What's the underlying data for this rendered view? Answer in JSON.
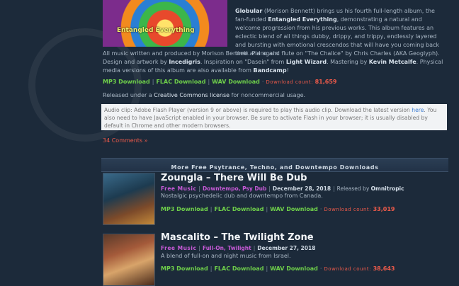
{
  "featured": {
    "art_title": "Entangled Everything",
    "paragraph1": {
      "artist": "Globular",
      "p1": " (Morison Bennett) brings us his fourth full-length album, the fan-funded ",
      "album": "Entangled Everything",
      "p2": ", demonstrating a natural and welcome progression from his previous works. This album features an eclectic blend of all things dubby, drippy, and trippy, endlessly layered and bursting with emotional crescendos that will have you coming back time and again."
    },
    "paragraph2": {
      "p1": "All music written and produced by Morison Bennett. Piano and flute on \"The Chalice\" by Chris Charles (AKA Geoglyph). Design and artwork by ",
      "designer": "Incedigris",
      "p2": ". Inspiration on \"Dasein\" from ",
      "inspiration": "Light Wizard",
      "p3": ". Mastering by ",
      "mastering": "Kevin Metcalfe",
      "p4": ". Physical media versions of this album are also available from ",
      "store": "Bandcamp",
      "p5": "!"
    },
    "downloads": {
      "mp3": "MP3 Download",
      "flac": "FLAC Download",
      "wav": "WAV Download",
      "count_label": "Download count:",
      "count": "81,659"
    },
    "license": {
      "p1": "Released under a ",
      "link": "Creative Commons license",
      "p2": " for noncommercial usage."
    },
    "audio_box": {
      "p1": "Audio clip: Adobe Flash Player (version 9 or above) is required to play this audio clip. Download the latest version ",
      "link": "here",
      "p2": ". You also need to have JavaScript enabled in your browser. Be sure to activate Flash in your browser; it is usually disabled by default in Chrome and other modern browsers."
    },
    "comments": "34 Comments »"
  },
  "section_header": "More Free Psytrance, Techno, and Downtempo Downloads",
  "entries": [
    {
      "title": "Zoungla – There Will Be Dub",
      "category": "Free Music",
      "genres": "Downtempo, Psy Dub",
      "date": "December 28, 2018",
      "release_prefix": "Released by",
      "label": "Omnitropic",
      "description": "Nostalgic psychedelic dub and downtempo from Canada.",
      "mp3": "MP3 Download",
      "flac": "FLAC Download",
      "wav": "WAV Download",
      "count_label": "Download count:",
      "count": "33,019"
    },
    {
      "title": "Mascalito – The Twilight Zone",
      "category": "Free Music",
      "genres": "Full-On, Twilight",
      "date": "December 27, 2018",
      "description": "A blend of full-on and night music from Israel.",
      "mp3": "MP3 Download",
      "flac": "FLAC Download",
      "wav": "WAV Download",
      "count_label": "Download count:",
      "count": "38,643"
    }
  ]
}
